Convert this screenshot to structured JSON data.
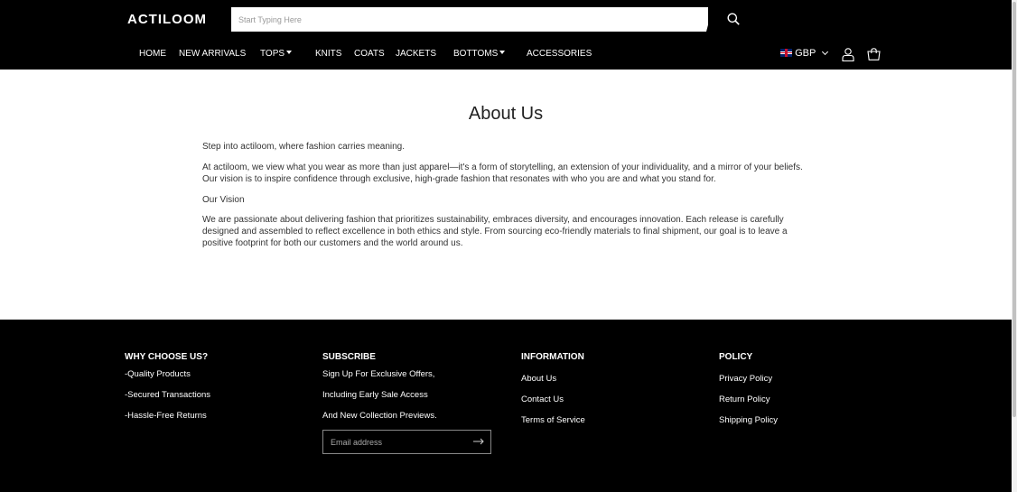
{
  "header": {
    "logo": "ACTILOOM",
    "search_placeholder": "Start Typing Here",
    "currency": "GBP"
  },
  "nav": [
    {
      "label": "HOME"
    },
    {
      "label": "NEW ARRIVALS"
    },
    {
      "label": "TOPS",
      "dropdown": true
    },
    {
      "label": "KNITS"
    },
    {
      "label": "COATS"
    },
    {
      "label": "JACKETS"
    },
    {
      "label": "BOTTOMS",
      "dropdown": true
    },
    {
      "label": "ACCESSORIES"
    }
  ],
  "main": {
    "title": "About Us",
    "intro": "Step into actiloom, where fashion carries meaning.",
    "paragraph1": "At actiloom, we view what you wear as more than just apparel—it's a form of storytelling, an extension of your individuality, and a mirror of your beliefs. Our vision is to inspire confidence through exclusive, high-grade fashion that resonates with who you are and what you stand for.",
    "vision_heading": "Our Vision",
    "paragraph2": "We are passionate about delivering fashion that prioritizes sustainability, embraces diversity, and encourages innovation. Each release is carefully designed and assembled to reflect excellence in both ethics and style. From sourcing eco-friendly materials to final shipment, our goal is to leave a positive footprint for both our customers and the world around us."
  },
  "footer": {
    "why": {
      "heading": "WHY CHOOSE US?",
      "items": [
        "-Quality Products",
        "-Secured Transactions",
        "-Hassle-Free Returns"
      ]
    },
    "subscribe": {
      "heading": "SUBSCRIBE",
      "lines": [
        "Sign Up For Exclusive Offers,",
        "Including Early Sale Access",
        "And New Collection Previews."
      ],
      "email_placeholder": "Email address"
    },
    "information": {
      "heading": "INFORMATION",
      "items": [
        "About Us",
        "Contact Us",
        "Terms of Service"
      ]
    },
    "policy": {
      "heading": "POLICY",
      "items": [
        "Privacy Policy",
        "Return Policy",
        "Shipping Policy"
      ]
    }
  },
  "colors": {
    "header_bg": "#000000",
    "footer_bg": "#000000",
    "text": "#333333"
  }
}
